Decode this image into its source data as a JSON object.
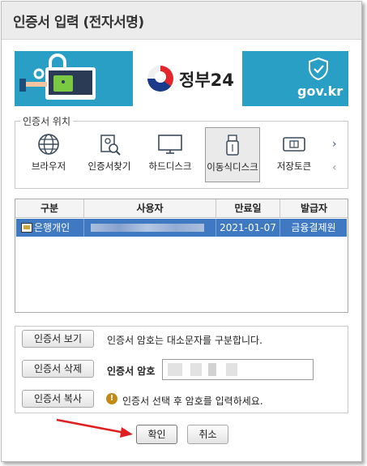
{
  "dialog": {
    "title": "인증서 입력 (전자서명)"
  },
  "banner": {
    "name": "정부24",
    "domain": "gov.kr"
  },
  "location": {
    "legend": "인증서 위치",
    "items": [
      {
        "label": "브라우저",
        "icon": "globe-icon"
      },
      {
        "label": "인증서찾기",
        "icon": "certificate-search-icon"
      },
      {
        "label": "하드디스크",
        "icon": "monitor-icon"
      },
      {
        "label": "이동식디스크",
        "icon": "usb-icon",
        "selected": true
      },
      {
        "label": "저장토큰",
        "icon": "token-icon"
      }
    ]
  },
  "table": {
    "headers": [
      "구분",
      "사용자",
      "만료일",
      "발급자"
    ],
    "rows": [
      {
        "type": "은행개인",
        "user": "",
        "expiry": "2021-01-07",
        "issuer": "금융결제원"
      }
    ]
  },
  "actions": {
    "view_label": "인증서 보기",
    "delete_label": "인증서 삭제",
    "copy_label": "인증서 복사",
    "case_note": "인증서 암호는 대소문자를 구분합니다.",
    "password_label": "인증서 암호",
    "hint": "인증서 선택 후 암호를 입력하세요."
  },
  "footer": {
    "ok_label": "확인",
    "cancel_label": "취소"
  },
  "colors": {
    "banner": "#2a9fc6",
    "selection": "#3f79c2",
    "pointer_arrow": "#e02020"
  }
}
